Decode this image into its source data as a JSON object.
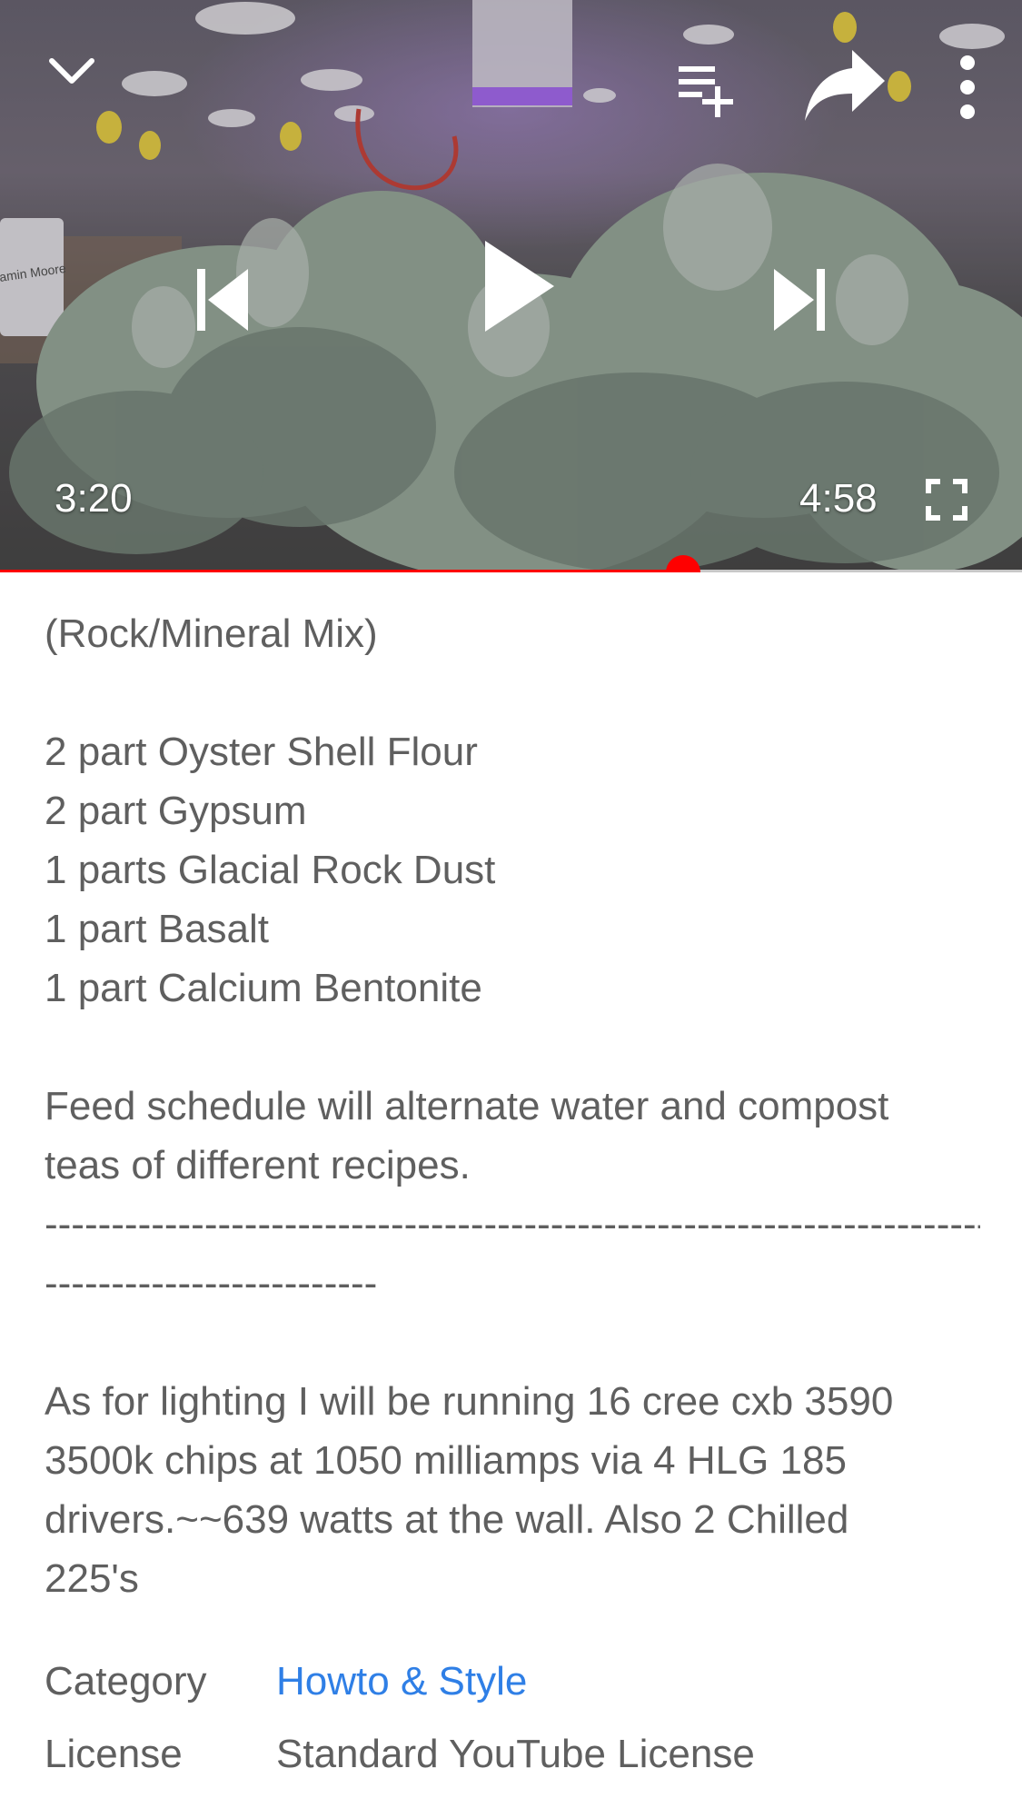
{
  "player": {
    "current_time": "3:20",
    "duration": "4:58",
    "progress": 0.668,
    "icons": {
      "minimize": "chevron-down-icon",
      "add_to_playlist": "playlist-add-icon",
      "share": "share-icon",
      "more": "more-vert-icon",
      "previous": "skip-previous-icon",
      "play": "play-icon",
      "next": "skip-next-icon",
      "fullscreen": "fullscreen-icon"
    },
    "colors": {
      "progress_played": "#ff0000",
      "progress_remaining": "#c8c8c8"
    },
    "scene_text": "amin Moore"
  },
  "description": {
    "heading_line": "(Rock/Mineral Mix)",
    "mix_lines": [
      "2 part Oyster Shell Flour",
      "2 part Gypsum",
      "1 parts Glacial Rock Dust",
      "1 part Basalt",
      "1 part Calcium Bentonite"
    ],
    "feed_lines": [
      "Feed schedule will alternate water and compost",
      "teas of different recipes."
    ],
    "separator_lines": [
      "-------------------------------------------------------------------------",
      "-------------------------"
    ],
    "lighting_lines": [
      "As for lighting I will be running 16 cree cxb 3590",
      "3500k chips at 1050 milliamps via 4 HLG 185",
      "drivers.~~639 watts at the wall. Also 2 Chilled",
      "225's"
    ]
  },
  "meta": {
    "category_label": "Category",
    "category_value": "Howto & Style",
    "license_label": "License",
    "license_value": "Standard YouTube License",
    "link_color": "#2f7fe6"
  }
}
